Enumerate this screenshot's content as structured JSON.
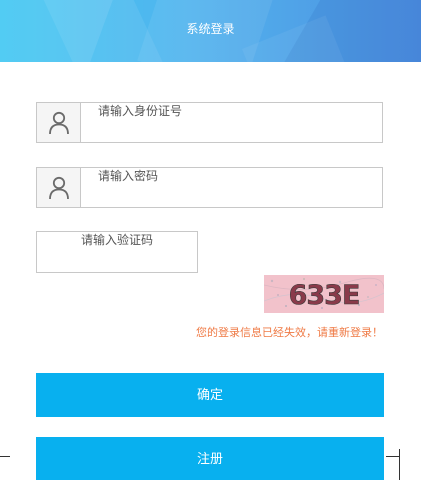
{
  "header": {
    "title": "系统登录"
  },
  "form": {
    "id_number": {
      "placeholder": "请输入身份证号",
      "value": ""
    },
    "password": {
      "placeholder": "请输入密码",
      "value": ""
    },
    "captcha": {
      "placeholder": "请输入验证码",
      "value": "",
      "image_text": "633E"
    }
  },
  "messages": {
    "error": "您的登录信息已经失效，请重新登录！"
  },
  "buttons": {
    "confirm_label": "确定",
    "register_label": "注册"
  },
  "icons": {
    "id_field": "user-icon",
    "password_field": "user-icon"
  },
  "colors": {
    "primary": "#08b0ef",
    "error": "#ef7a45",
    "header_start": "#3fc7f2",
    "header_end": "#4d8fe0",
    "captcha_bg": "#f2c2cb",
    "captcha_text": "#8a3a4a"
  }
}
